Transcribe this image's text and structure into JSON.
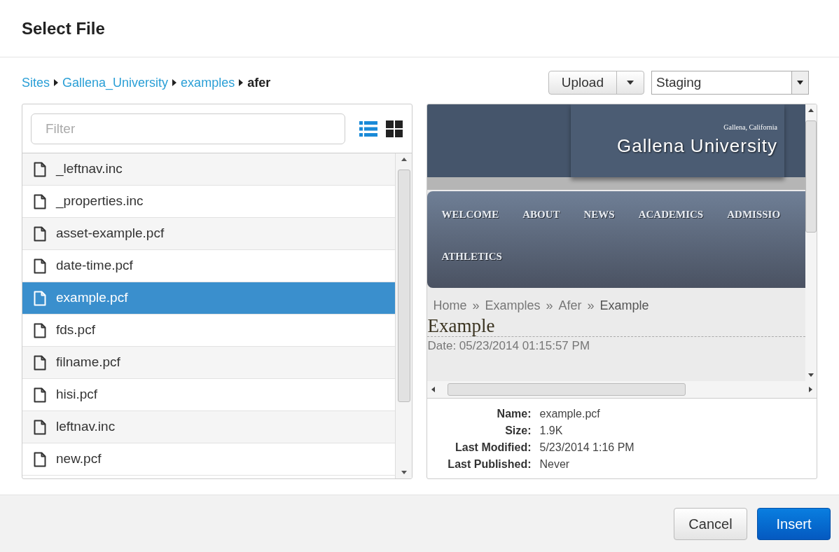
{
  "dialog": {
    "title": "Select File"
  },
  "breadcrumb": [
    {
      "label": "Sites",
      "link": true
    },
    {
      "label": "Gallena_University",
      "link": true
    },
    {
      "label": "examples",
      "link": true
    },
    {
      "label": "afer",
      "link": false
    }
  ],
  "upload_button": {
    "label": "Upload"
  },
  "environment_select": {
    "value": "Staging"
  },
  "filter": {
    "placeholder": "Filter"
  },
  "view_toggle": [
    {
      "kind": "list",
      "selected": true
    },
    {
      "kind": "grid",
      "selected": false
    }
  ],
  "files": [
    {
      "name": "_leftnav.inc",
      "selected": false
    },
    {
      "name": "_properties.inc",
      "selected": false
    },
    {
      "name": "asset-example.pcf",
      "selected": false
    },
    {
      "name": "date-time.pcf",
      "selected": false
    },
    {
      "name": "example.pcf",
      "selected": true
    },
    {
      "name": "fds.pcf",
      "selected": false
    },
    {
      "name": "filname.pcf",
      "selected": false
    },
    {
      "name": "hisi.pcf",
      "selected": false
    },
    {
      "name": "leftnav.inc",
      "selected": false
    },
    {
      "name": "new.pcf",
      "selected": false
    }
  ],
  "preview": {
    "location": "Gallena, California",
    "site_name": "Gallena University",
    "nav": [
      "WELCOME",
      "ABOUT",
      "NEWS",
      "ACADEMICS",
      "ADMISSIO",
      "ATHLETICS"
    ],
    "crumbs": [
      "Home",
      "»",
      "Examples",
      "»",
      "Afer",
      "»",
      "Example"
    ],
    "heading": "Example",
    "date": "Date: 05/23/2014 01:15:57 PM"
  },
  "details": [
    {
      "label": "Name:",
      "value": "example.pcf"
    },
    {
      "label": "Size:",
      "value": "1.9K"
    },
    {
      "label": "Last Modified:",
      "value": "5/23/2014 1:16 PM"
    },
    {
      "label": "Last Published:",
      "value": "Never"
    }
  ],
  "buttons": [
    {
      "label": "Cancel",
      "kind": "secondary"
    },
    {
      "label": "Insert",
      "kind": "primary"
    }
  ]
}
